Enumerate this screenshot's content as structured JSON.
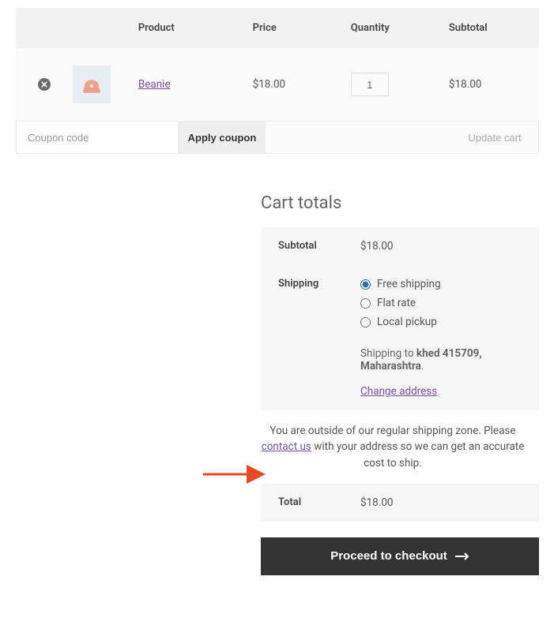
{
  "headers": {
    "product": "Product",
    "price": "Price",
    "quantity": "Quantity",
    "subtotal": "Subtotal"
  },
  "item": {
    "name": "Beanie",
    "price": "$18.00",
    "qty": "1",
    "subtotal": "$18.00"
  },
  "coupon": {
    "placeholder": "Coupon code",
    "apply": "Apply coupon",
    "update": "Update cart"
  },
  "totals": {
    "title": "Cart totals",
    "subtotal_label": "Subtotal",
    "subtotal": "$18.00",
    "shipping_label": "Shipping",
    "opts": {
      "free": "Free shipping",
      "flat": "Flat rate",
      "pickup": "Local pickup"
    },
    "ship_to_prefix": "Shipping to ",
    "ship_to_dest": "khed 415709, Maharashtra",
    "change": "Change address",
    "notice_a": "You are outside of our regular shipping zone. Please ",
    "notice_link": "contact us",
    "notice_b": " with your address so we can get an accurate cost to ship.",
    "total_label": "Total",
    "total": "$18.00"
  },
  "checkout": "Proceed to checkout"
}
